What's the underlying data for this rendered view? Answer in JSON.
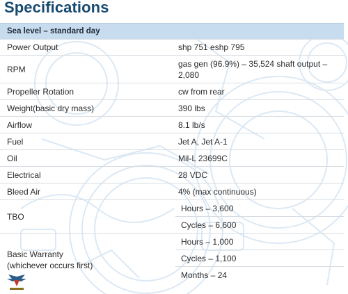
{
  "page": {
    "title": "Specifications"
  },
  "section": {
    "label": "Sea level – standard day"
  },
  "rows": [
    {
      "label": "Power Output",
      "value": "shp 751 eshp 795"
    },
    {
      "label": "RPM",
      "value": "gas gen (96.9%) – 35,524 shaft output – 2,080"
    },
    {
      "label": "Propeller Rotation",
      "value": "cw from rear"
    },
    {
      "label": "Weight(basic dry mass)",
      "value": "390 lbs"
    },
    {
      "label": "Airflow",
      "value": "8.1 lb/s"
    },
    {
      "label": "Fuel",
      "value": "Jet A, Jet A-1"
    },
    {
      "label": "Oil",
      "value": "Mil-L 23699C"
    },
    {
      "label": "Electrical",
      "value": "28 VDC"
    },
    {
      "label": "Bleed Air",
      "value": "4% (max continuous)"
    }
  ],
  "tbo": {
    "label": "TBO",
    "values": [
      "Hours – 3,600",
      "Cycles – 6,600"
    ]
  },
  "warranty": {
    "label_line1": "Basic Warranty",
    "label_line2": "(whichever occurs first)",
    "values": [
      "Hours – 1,000",
      "Cycles – 1,100",
      "Months – 24"
    ]
  },
  "colors": {
    "title": "#174a6f",
    "section_bg": "#c8dcf0",
    "line_art": "#dce8f3"
  }
}
